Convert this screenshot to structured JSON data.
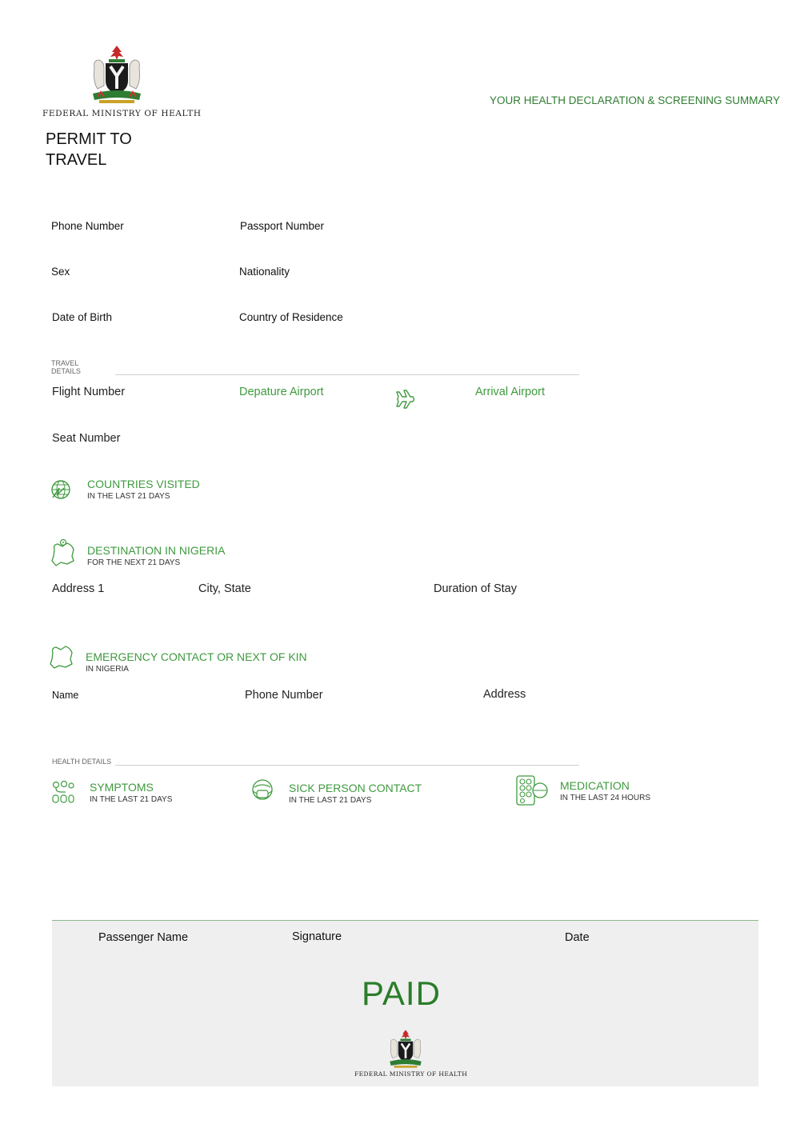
{
  "header": {
    "ministry": "FEDERAL MINISTRY OF HEALTH",
    "title": "PERMIT TO TRAVEL",
    "summary": "YOUR HEALTH DECLARATION & SCREENING SUMMARY"
  },
  "personal": {
    "phone_label": "Phone Number",
    "passport_label": "Passport Number",
    "sex_label": "Sex",
    "nationality_label": "Nationality",
    "dob_label": "Date of Birth",
    "residence_label": "Country of Residence"
  },
  "travel": {
    "section_label": "TRAVEL DETAILS",
    "flight_label": "Flight Number",
    "departure_label": "Depature Airport",
    "arrival_label": "Arrival Airport",
    "seat_label": "Seat Number",
    "plane_icon": "airplane-icon"
  },
  "countries": {
    "title": "COUNTRIES VISITED",
    "subtitle": "IN THE LAST 21 DAYS",
    "icon": "globe-icon"
  },
  "destination": {
    "title": "DESTINATION IN NIGERIA",
    "subtitle": "FOR THE NEXT 21 DAYS",
    "address_label": "Address 1",
    "city_label": "City, State",
    "duration_label": "Duration of Stay",
    "icon": "nigeria-map-pin-icon"
  },
  "emergency": {
    "title": "EMERGENCY CONTACT OR NEXT OF KIN",
    "subtitle": "IN NIGERIA",
    "name_label": "Name",
    "phone_label": "Phone Number",
    "address_label": "Address",
    "icon": "nigeria-map-icon"
  },
  "health": {
    "section_label": "HEALTH DETAILS",
    "symptoms_title": "SYMPTOMS",
    "symptoms_sub": "IN THE LAST 21 DAYS",
    "contact_title": "SICK PERSON CONTACT",
    "contact_sub": "IN THE LAST 21 DAYS",
    "medication_title": "MEDICATION",
    "medication_sub": "IN THE LAST 24 HOURS"
  },
  "footer": {
    "passenger_label": "Passenger Name",
    "signature_label": "Signature",
    "date_label": "Date",
    "paid": "PAID",
    "ministry": "FEDERAL MINISTRY OF HEALTH"
  },
  "colors": {
    "accent_green": "#3f9a3f",
    "dark_green": "#2a7d2a",
    "footer_bg": "#efefef"
  }
}
